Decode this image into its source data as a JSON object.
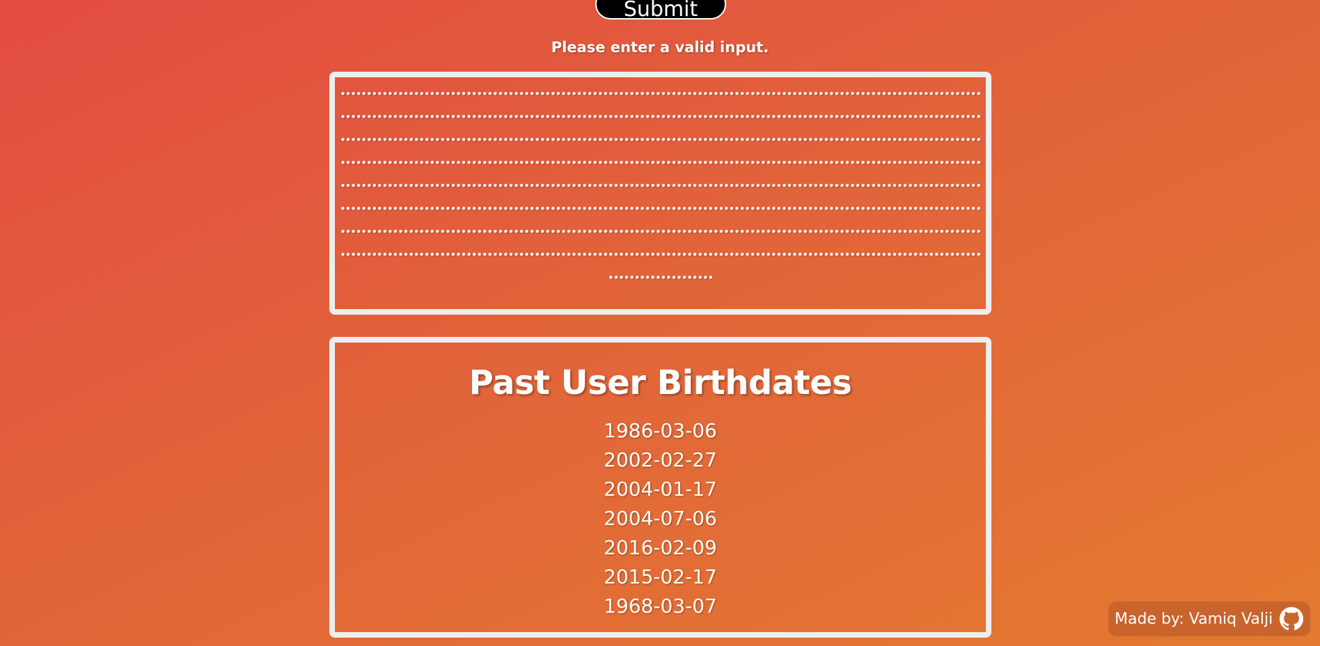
{
  "form": {
    "submit_label": "Submit",
    "error_message": "Please enter a valid input."
  },
  "password_display": {
    "masked_value": "••••••••••••••••••••••••••••••••••••••••••••••••••••••••••••••••••••••••••••••••••••••••••••••••••••••••••••••••••••••••••••••••••••••••••••••••••••••••••••••••••••••••••••••••••••••••••••••••••••••••••••••••••••••••••••••••••••••••••••••••••••••••••••••••••••••••••••••••••••••••••••••••••••••••••••••••••••••••••••••••••••••••••••••••••••••••••••••••••••••••••••••••••••••••••••••••••••••••••••••••••••••••••••••••••••••••••••••••••••••••••••••••••••••••••••••••••••••••••••••••••••••••••••••••••••••••••••••••••••••••••••••••••••••••••••••••••••••••••••••••••••••••••••••••••••••••••••••••••••••••••••••••••••••••••••••••••••••••••••••••••••••••••••••••••••••••••••••••••••••••••••••••••••••••••••••••••••••••••••••••••••••••••••••••••••••••••••••••••••••••••••••••••••••••••••••••••••••••••••••••••••••••••••••••••••••••••••••••••••••••••••••••••••••••••••••••••••••••••••••••••••••••••••••••••••••••••••••••••••••••••••••••••••••••••••••••••••••••••••••••••••••••••••••••••••••••••••••••••••"
  },
  "history": {
    "title": "Past User Birthdates",
    "dates": [
      "1986-03-06",
      "2002-02-27",
      "2004-01-17",
      "2004-07-06",
      "2016-02-09",
      "2015-02-17",
      "1968-03-07"
    ]
  },
  "footer": {
    "credit": "Made by: Vamiq Valji",
    "icon": "github-icon"
  },
  "colors": {
    "gradient_start": "#e24b41",
    "gradient_end": "#e37a30",
    "border": "#eeeeee",
    "button_bg": "#000000"
  }
}
